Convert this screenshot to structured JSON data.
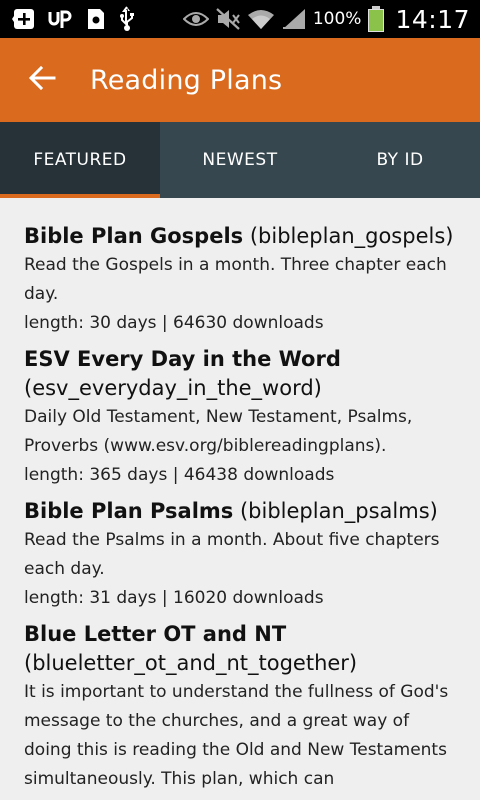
{
  "status_bar": {
    "battery_text": "100%",
    "clock": "14:17",
    "battery_level": 1.0,
    "icons": [
      "add-box-icon",
      "up-icon",
      "device-icon",
      "usb-icon",
      "eye-icon",
      "mute-icon",
      "wifi-icon",
      "signal-icon",
      "battery-icon"
    ]
  },
  "app_bar": {
    "title": "Reading Plans",
    "back_icon": "arrow-back-icon",
    "color": "#d96a1e"
  },
  "tabs": [
    {
      "label": "FEATURED",
      "active": true
    },
    {
      "label": "NEWEST",
      "active": false
    },
    {
      "label": "BY ID",
      "active": false
    }
  ],
  "plans": [
    {
      "name": "Bible Plan Gospels",
      "id": "(bibleplan_gospels)",
      "description": "Read the Gospels in a month. Three chapter each day.",
      "meta": "length: 30 days | 64630 downloads"
    },
    {
      "name": "ESV Every Day in the Word",
      "id": "(esv_everyday_in_the_word)",
      "description": "Daily Old Testament, New Testament, Psalms, Proverbs (www.esv.org/biblereadingplans).",
      "meta": "length: 365 days | 46438 downloads"
    },
    {
      "name": "Bible Plan Psalms",
      "id": "(bibleplan_psalms)",
      "description": "Read the Psalms in a month. About five chapters each day.",
      "meta": "length: 31 days | 16020 downloads"
    },
    {
      "name": "Blue Letter OT and NT",
      "id": "(blueletter_ot_and_nt_together)",
      "description": "It is important to understand the fullness of God's message to the churches, and a great way of doing this is reading the Old and New Testaments simultaneously. This plan, which can",
      "meta": ""
    }
  ]
}
